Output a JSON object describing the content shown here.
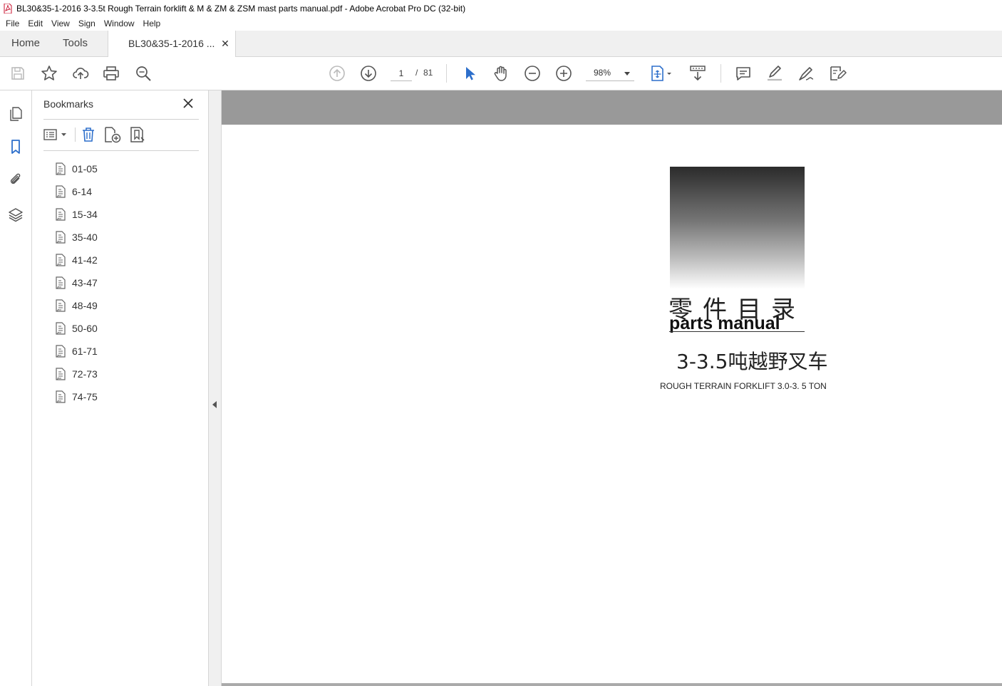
{
  "window": {
    "title": "BL30&35-1-2016 3-3.5t Rough Terrain forklift & M & ZM & ZSM mast parts manual.pdf - Adobe Acrobat Pro DC (32-bit)"
  },
  "menu": [
    "File",
    "Edit",
    "View",
    "Sign",
    "Window",
    "Help"
  ],
  "tabs": {
    "home": "Home",
    "tools": "Tools",
    "document": "BL30&35-1-2016 ...",
    "close_glyph": "✕"
  },
  "toolbar": {
    "page_current": "1",
    "page_separator": "/",
    "page_total": "81",
    "zoom": "98%"
  },
  "bookmarks": {
    "title": "Bookmarks",
    "items": [
      "01-05",
      "6-14",
      "15-34",
      "35-40",
      "41-42",
      "43-47",
      "48-49",
      "50-60",
      "61-71",
      "72-73",
      "74-75"
    ]
  },
  "document": {
    "cover_cn": "零件目录",
    "cover_en": "parts manual",
    "subtitle_cn": "3-3.5吨越野叉车",
    "subtitle_en": "ROUGH TERRAIN FORKLIFT 3.0-3. 5 TON"
  },
  "colors": {
    "accent_blue": "#2d6fcb",
    "icon_gray": "#555555",
    "tab_bg": "#f0f0f0",
    "doc_band": "#999999"
  }
}
